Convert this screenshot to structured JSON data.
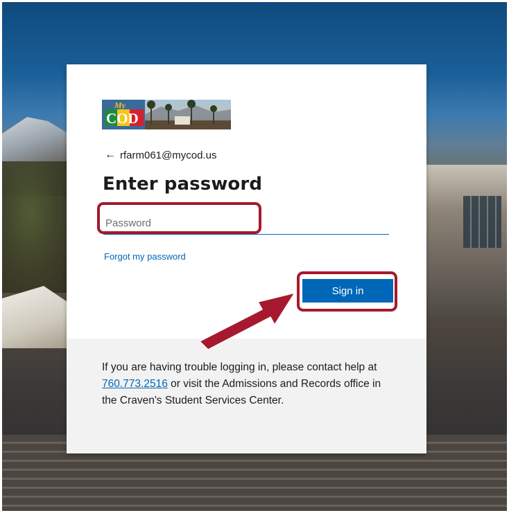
{
  "card": {
    "identity_email": "rfarm061@mycod.us",
    "heading": "Enter password",
    "forgot_link": "Forgot my password",
    "signin_label": "Sign in"
  },
  "password_field": {
    "value": "",
    "placeholder": "Password"
  },
  "footer": {
    "text_before": "If you are having trouble logging in, please contact help at ",
    "phone": "760.773.2516",
    "text_after": " or visit the Admissions and Records office in the Craven's Student Services Center."
  },
  "logo": {
    "text_my": "My",
    "text_cod": "COD"
  },
  "icons": {
    "back": "left-arrow-icon",
    "annotation": "callout-arrow"
  },
  "colors": {
    "accent": "#0067b8",
    "highlight": "#a6192e",
    "text": "#1b1b1b",
    "footer_bg": "#f2f2f2"
  }
}
